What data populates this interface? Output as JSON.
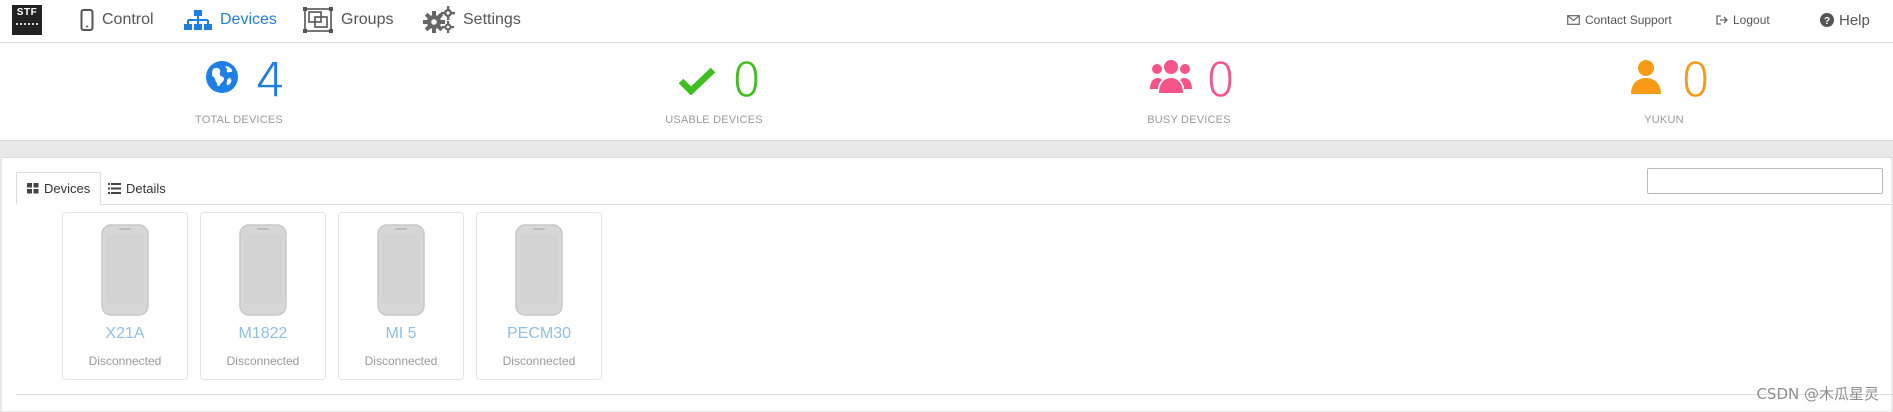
{
  "app": {
    "logo_text": "STF"
  },
  "nav": {
    "items": [
      {
        "label": "Control",
        "icon": "mobile-phone-icon"
      },
      {
        "label": "Devices",
        "icon": "sitemap-icon",
        "active": true
      },
      {
        "label": "Groups",
        "icon": "groups-icon"
      },
      {
        "label": "Settings",
        "icon": "gears-icon"
      }
    ],
    "right": {
      "contact_support": "Contact Support",
      "logout": "Logout",
      "help": "Help"
    }
  },
  "stats": [
    {
      "value": "4",
      "label": "TOTAL DEVICES",
      "icon": "globe-icon",
      "color": "#1d7ee3"
    },
    {
      "value": "0",
      "label": "USABLE DEVICES",
      "icon": "check-icon",
      "color": "#3fbf1e"
    },
    {
      "value": "0",
      "label": "BUSY DEVICES",
      "icon": "users-icon",
      "color": "#f5548a"
    },
    {
      "value": "0",
      "label": "YUKUN",
      "icon": "user-icon",
      "color": "#f79a16"
    }
  ],
  "tabs": [
    {
      "label": "Devices",
      "icon": "th-large-icon",
      "active": true
    },
    {
      "label": "Details",
      "icon": "list-icon"
    }
  ],
  "search": {
    "value": "",
    "placeholder": ""
  },
  "devices": [
    {
      "name": "X21A",
      "status": "Disconnected"
    },
    {
      "name": "M1822",
      "status": "Disconnected"
    },
    {
      "name": "MI 5",
      "status": "Disconnected"
    },
    {
      "name": "PECM30",
      "status": "Disconnected"
    }
  ],
  "watermark": "CSDN @木瓜星灵"
}
